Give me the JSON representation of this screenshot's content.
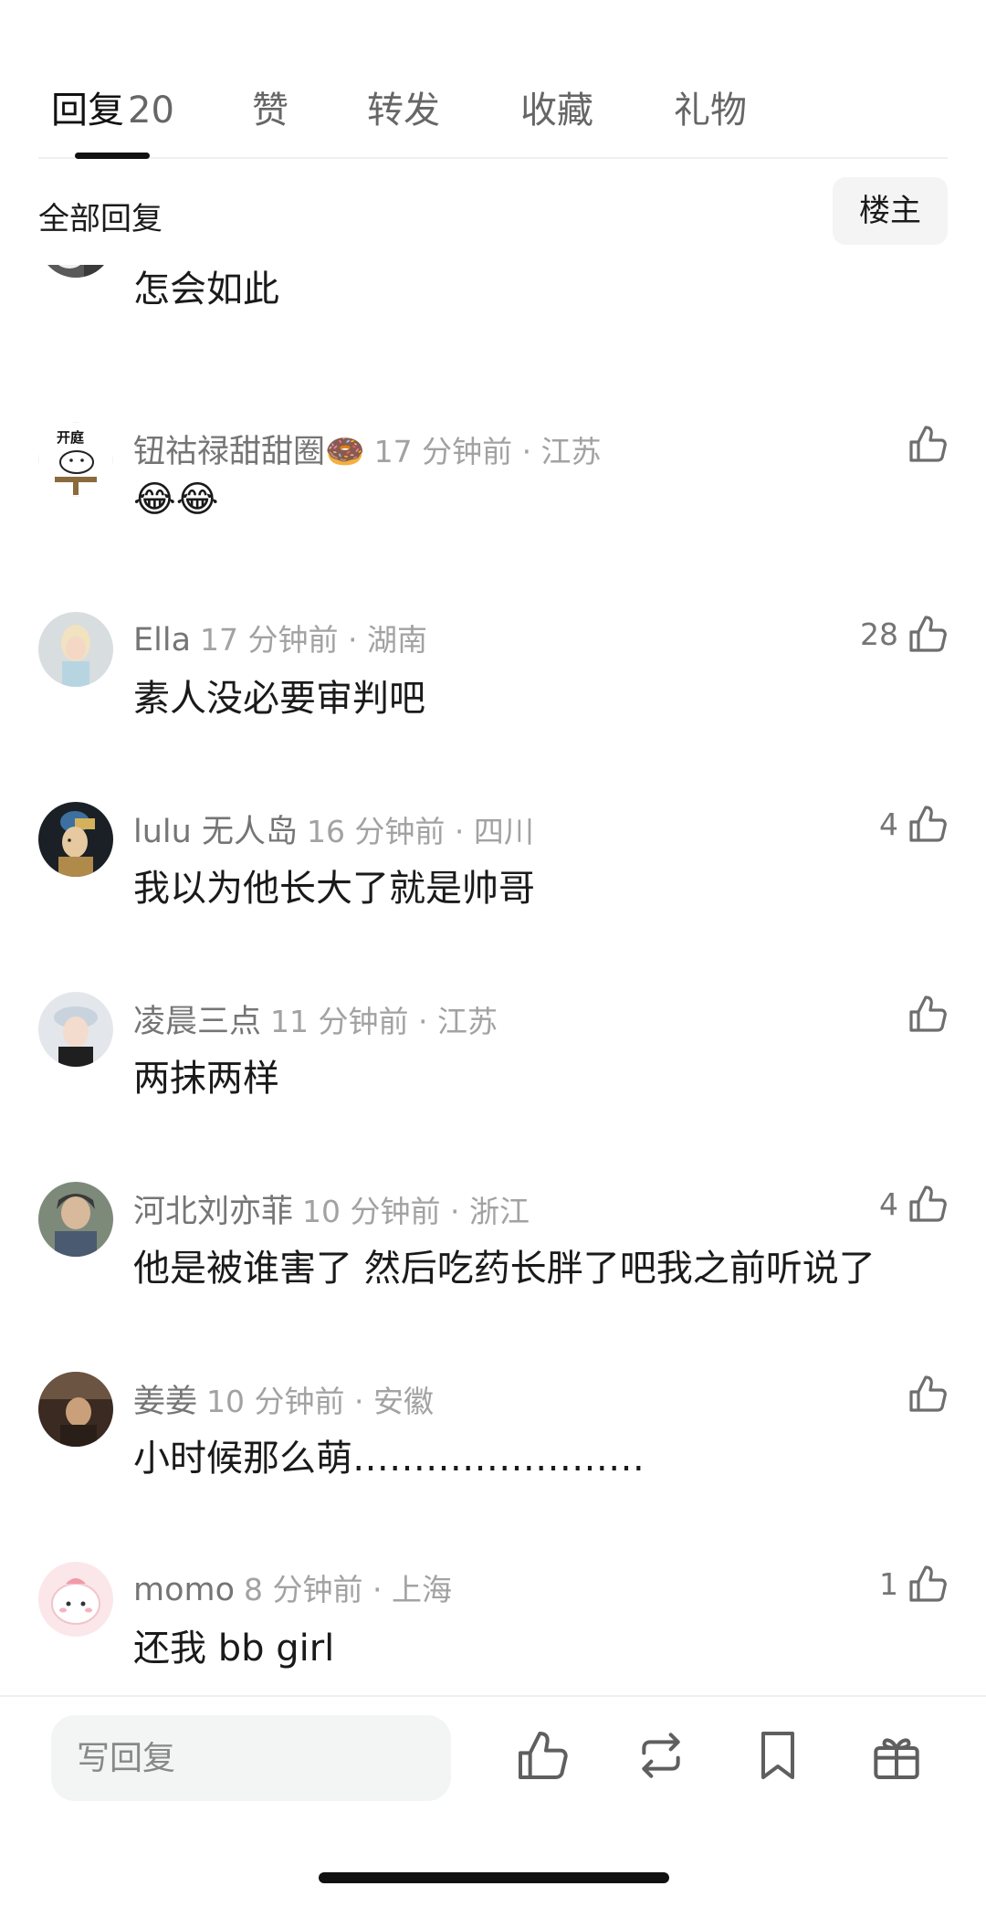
{
  "tabs": [
    {
      "label": "回复",
      "count": "20"
    },
    {
      "label": "赞"
    },
    {
      "label": "转发"
    },
    {
      "label": "收藏"
    },
    {
      "label": "礼物"
    }
  ],
  "filter": {
    "label": "全部回复",
    "owner_button": "楼主"
  },
  "comments": [
    {
      "name": "",
      "time": "",
      "text": "怎会如此",
      "likes": ""
    },
    {
      "name": "钮祜禄甜甜圈🍩",
      "time": "17 分钟前 · 江苏",
      "text": "😂😂",
      "likes": ""
    },
    {
      "name": "Ella",
      "time": "17 分钟前 · 湖南",
      "text": "素人没必要审判吧",
      "likes": "28"
    },
    {
      "name": "lulu 无人岛",
      "time": "16 分钟前 · 四川",
      "text": "我以为他长大了就是帅哥",
      "likes": "4"
    },
    {
      "name": "凌晨三点",
      "time": "11 分钟前 · 江苏",
      "text": "两抹两样",
      "likes": ""
    },
    {
      "name": "河北刘亦菲",
      "time": "10 分钟前 · 浙江",
      "text": "他是被谁害了 然后吃药长胖了吧我之前听说了",
      "likes": "4"
    },
    {
      "name": "姜姜",
      "time": "10 分钟前 · 安徽",
      "text": "小时候那么萌……………………",
      "likes": ""
    },
    {
      "name": "momo",
      "time": "8 分钟前 · 上海",
      "text": "还我 bb girl",
      "likes": "1"
    }
  ],
  "avatar_text": {
    "kaiting": "开庭"
  },
  "bottom_bar": {
    "reply_placeholder": "写回复"
  },
  "icons": {
    "like": "thumbs-up-icon",
    "repost": "repost-icon",
    "bookmark": "bookmark-icon",
    "gift": "gift-icon"
  }
}
